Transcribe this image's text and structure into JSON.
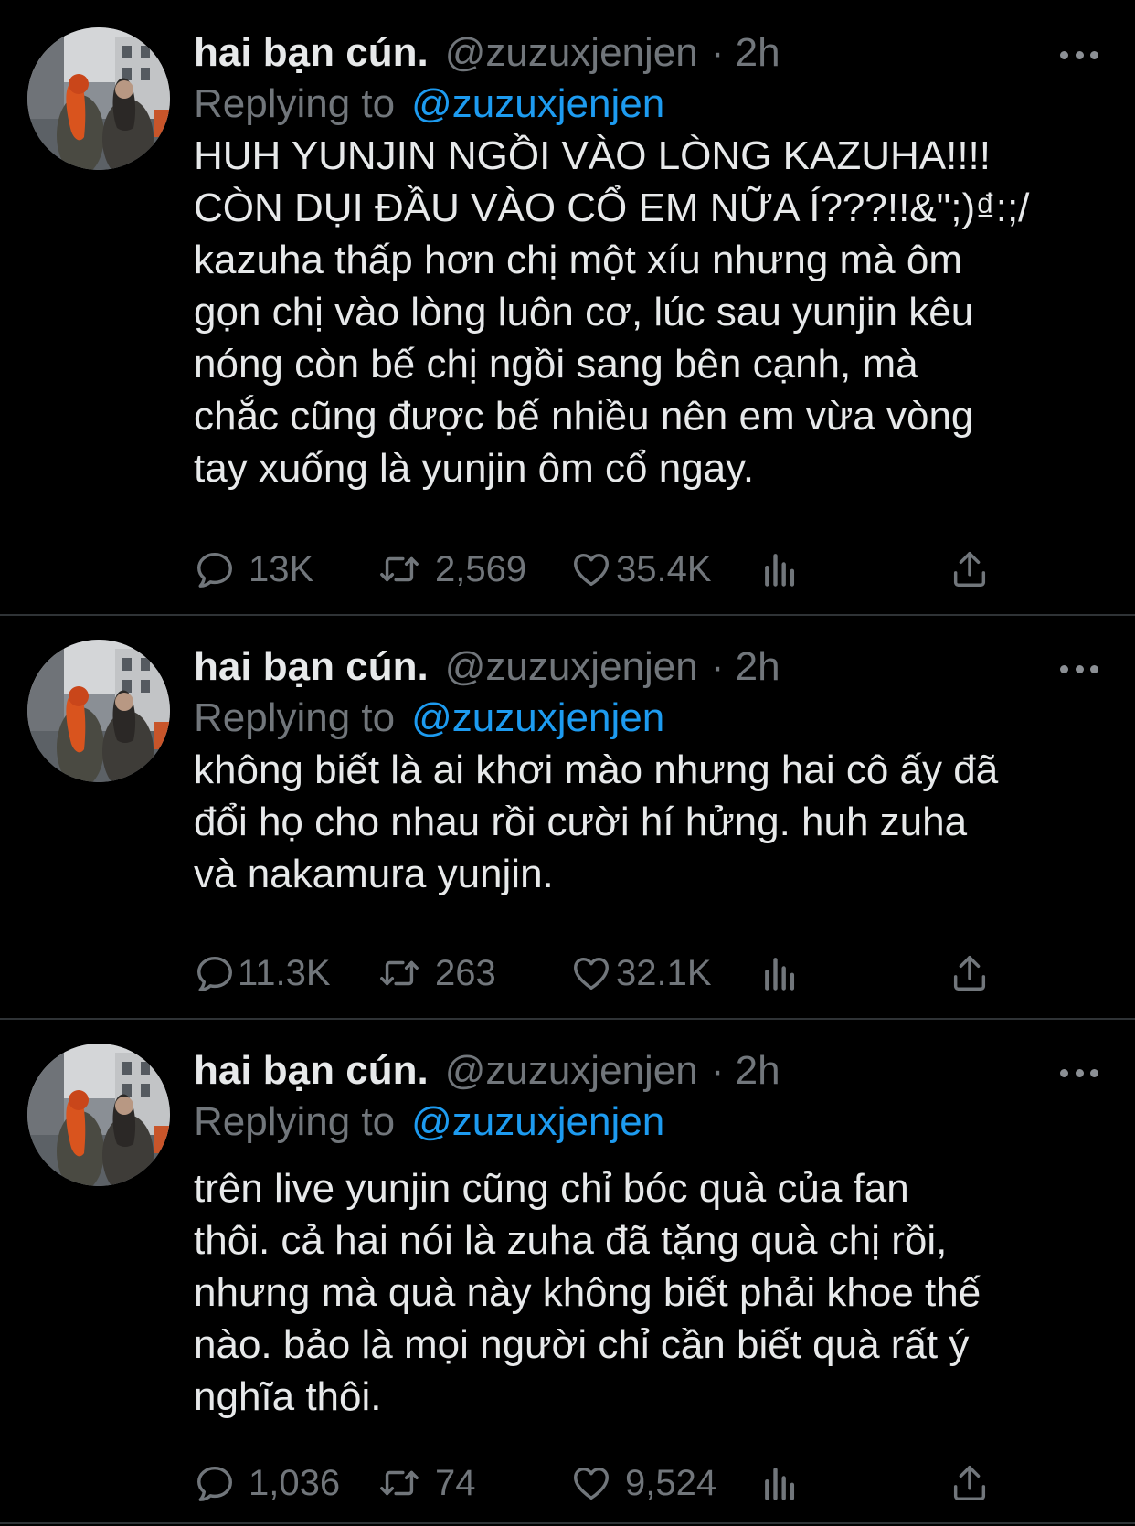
{
  "tweets": [
    {
      "author_name": "hai bạn cún.",
      "handle": "@zuzuxjenjen",
      "time": "· 2h",
      "replying_prefix": "Replying to",
      "replying_to": "@zuzuxjenjen",
      "lines": [
        "HUH YUNJIN NGỒI VÀO LÒNG KAZUHA!!!!",
        "CÒN DỤI ĐẦU VÀO CỔ EM NỮA Í???!!&\";)₫:;/",
        "kazuha thấp hơn chị một xíu nhưng mà ôm",
        "gọn chị vào lòng luôn cơ, lúc sau yunjin kêu",
        "nóng còn bế chị ngồi sang bên cạnh, mà",
        "chắc cũng được bế nhiều nên em vừa vòng",
        "tay xuống là yunjin ôm cổ ngay."
      ],
      "replies": "13K",
      "retweets": "2,569",
      "likes": "35.4K"
    },
    {
      "author_name": "hai bạn cún.",
      "handle": "@zuzuxjenjen",
      "time": "· 2h",
      "replying_prefix": "Replying to",
      "replying_to": "@zuzuxjenjen",
      "lines": [
        "không biết là ai khơi mào nhưng hai cô ấy đã",
        "đổi họ cho nhau rồi cười hí hửng. huh zuha",
        "và nakamura yunjin."
      ],
      "replies": "11.3K",
      "retweets": "263",
      "likes": "32.1K"
    },
    {
      "author_name": "hai bạn cún.",
      "handle": "@zuzuxjenjen",
      "time": "· 2h",
      "replying_prefix": "Replying to",
      "replying_to": "@zuzuxjenjen",
      "lines": [
        "trên live yunjin cũng chỉ bóc quà của fan",
        "thôi. cả hai nói là zuha đã tặng quà chị rồi,",
        "nhưng mà quà này không biết phải khoe thế",
        "nào. bảo là mọi người chỉ cần biết quà rất ý",
        "nghĩa thôi."
      ],
      "replies": "1,036",
      "retweets": "74",
      "likes": "9,524"
    }
  ],
  "icons": {
    "reply": "reply-icon",
    "retweet": "retweet-icon",
    "like": "heart-icon",
    "analytics": "analytics-icon",
    "share": "share-icon",
    "more": "more-icon"
  },
  "colors": {
    "background": "#000000",
    "text": "#e7e9ea",
    "muted": "#71767b",
    "link": "#1d9bf0"
  }
}
